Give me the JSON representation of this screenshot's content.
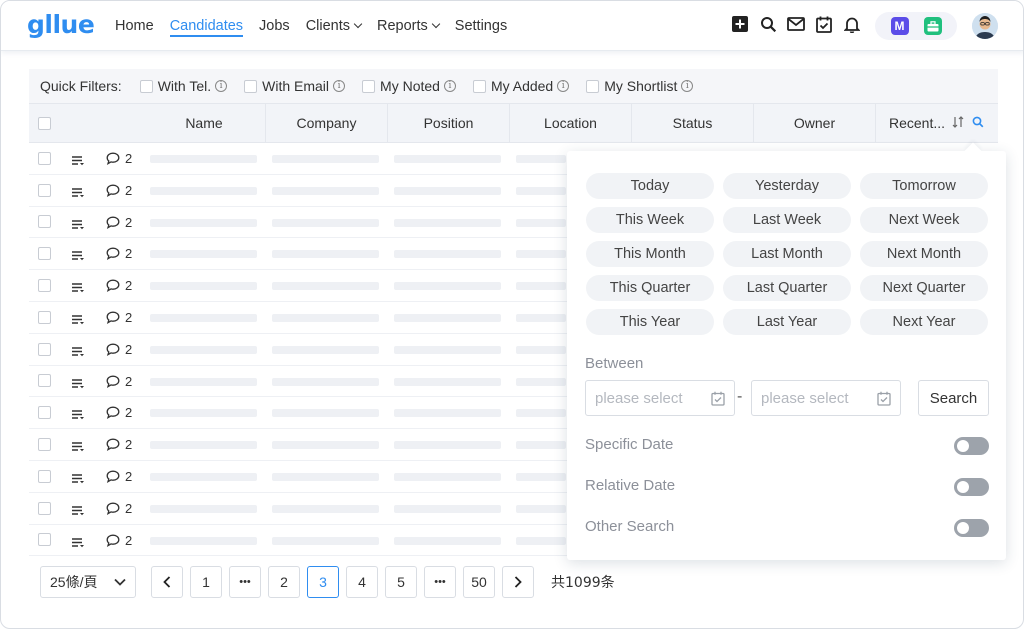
{
  "brand": {
    "logo_text": "gllue",
    "accent": "#2f8df0"
  },
  "nav": {
    "items": [
      {
        "label": "Home",
        "has_caret": false
      },
      {
        "label": "Candidates",
        "has_caret": false,
        "active": true
      },
      {
        "label": "Jobs",
        "has_caret": false
      },
      {
        "label": "Clients",
        "has_caret": true
      },
      {
        "label": "Reports",
        "has_caret": true
      },
      {
        "label": "Settings",
        "has_caret": false
      }
    ]
  },
  "toolbar": {
    "icons": [
      "add-icon",
      "search-icon",
      "mail-icon",
      "calendar-check-icon",
      "bell-icon"
    ],
    "apps": [
      {
        "label": "M",
        "color": "#5b4de8"
      },
      {
        "color": "#20c07e"
      }
    ]
  },
  "quick_filters": {
    "label": "Quick Filters:",
    "items": [
      "With Tel.",
      "With Email",
      "My Noted",
      "My Added",
      "My Shortlist"
    ]
  },
  "table": {
    "columns": [
      "Name",
      "Company",
      "Position",
      "Location",
      "Status",
      "Owner",
      "Recent..."
    ],
    "row_count": 13,
    "comment_count": "2"
  },
  "pagination": {
    "page_size": "25條/頁",
    "pages": [
      "1",
      "•••",
      "2",
      "3",
      "4",
      "5",
      "•••",
      "50"
    ],
    "current": "3",
    "total": "共1099条"
  },
  "date_filter": {
    "presets": [
      "Today",
      "Yesterday",
      "Tomorrow",
      "This Week",
      "Last Week",
      "Next Week",
      "This Month",
      "Last Month",
      "Next Month",
      "This Quarter",
      "Last Quarter",
      "Next Quarter",
      "This Year",
      "Last Year",
      "Next Year"
    ],
    "between_label": "Between",
    "start_placeholder": "please select",
    "end_placeholder": "please select",
    "range_separator": "-",
    "search_label": "Search",
    "options": [
      {
        "label": "Specific Date",
        "enabled": false
      },
      {
        "label": "Relative Date",
        "enabled": false
      },
      {
        "label": "Other Search",
        "enabled": false
      }
    ]
  }
}
